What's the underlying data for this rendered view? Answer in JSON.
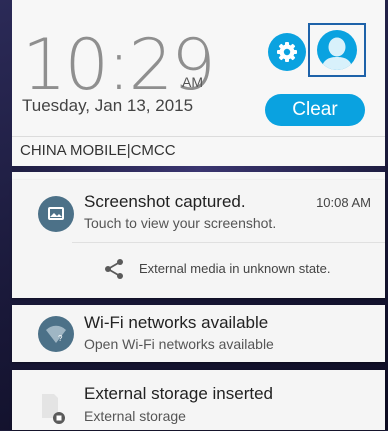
{
  "header": {
    "time": "10:29",
    "ampm": "AM",
    "date": "Tuesday, Jan 13, 2015",
    "clear_label": "Clear",
    "carrier": "CHINA MOBILE|CMCC"
  },
  "notifications": [
    {
      "title": "Screenshot captured.",
      "text": "Touch to view your screenshot.",
      "time": "10:08 AM",
      "icon": "image-icon",
      "action_icon": "share-icon",
      "action_text": "External media in unknown state."
    },
    {
      "title": "Wi-Fi networks available",
      "text": "Open Wi-Fi networks available",
      "icon": "wifi-icon"
    },
    {
      "title": "External storage inserted",
      "text": "External storage",
      "icon": "sd-card-icon"
    }
  ],
  "colors": {
    "accent": "#0aa2e0",
    "notification_bg": "#f5f5f5",
    "panel_bg": "#1d1c3a"
  }
}
